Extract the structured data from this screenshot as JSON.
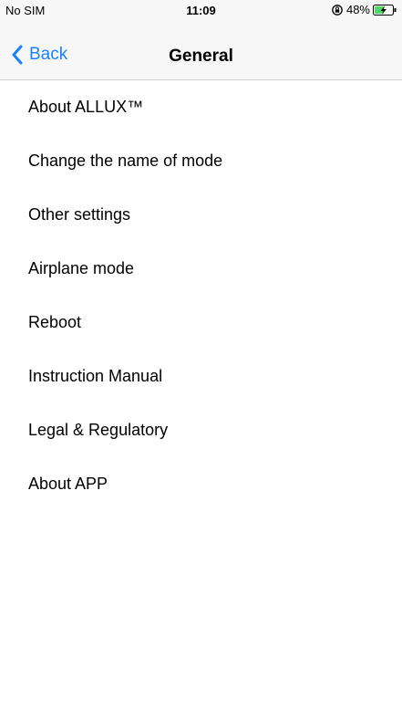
{
  "status_bar": {
    "carrier": "No SIM",
    "time": "11:09",
    "battery": "48%",
    "lock_icon": "orientation-lock-icon",
    "battery_icon": "battery-charging-icon"
  },
  "nav": {
    "back_label": "Back",
    "title": "General",
    "accent_color": "#1a82fb"
  },
  "menu": {
    "items": [
      {
        "label": "About ALLUX™"
      },
      {
        "label": "Change the name of mode"
      },
      {
        "label": "Other settings"
      },
      {
        "label": "Airplane mode"
      },
      {
        "label": "Reboot"
      },
      {
        "label": "Instruction Manual"
      },
      {
        "label": "Legal & Regulatory"
      },
      {
        "label": "About APP"
      }
    ]
  }
}
